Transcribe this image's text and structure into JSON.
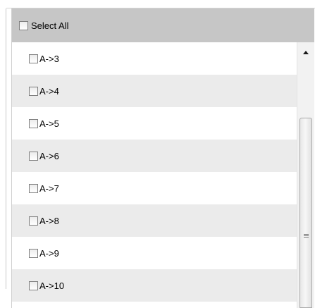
{
  "header": {
    "select_all_label": "Select All",
    "select_all_checked": false
  },
  "items": [
    {
      "label": "A->3",
      "checked": false
    },
    {
      "label": "A->4",
      "checked": false
    },
    {
      "label": "A->5",
      "checked": false
    },
    {
      "label": "A->6",
      "checked": false
    },
    {
      "label": "A->7",
      "checked": false
    },
    {
      "label": "A->8",
      "checked": false
    },
    {
      "label": "A->9",
      "checked": false
    },
    {
      "label": "A->10",
      "checked": false
    }
  ],
  "colors": {
    "header_bg": "#c6c6c6",
    "row_alt_bg": "#ebebeb",
    "row_bg": "#ffffff"
  }
}
